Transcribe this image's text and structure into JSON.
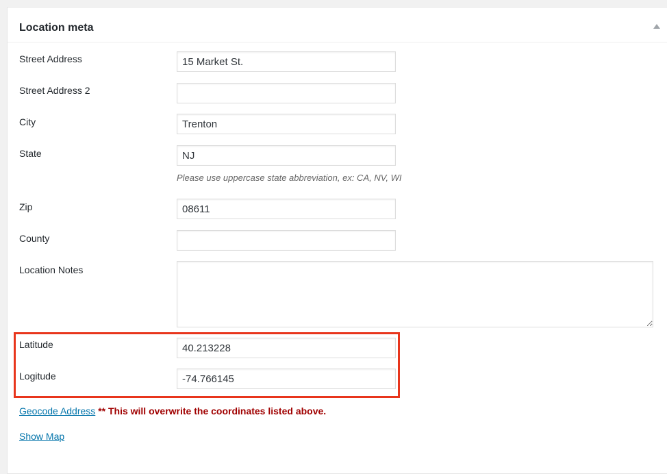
{
  "metabox": {
    "title": "Location meta"
  },
  "fields": {
    "street_address": {
      "label": "Street Address",
      "value": "15 Market St."
    },
    "street_address_2": {
      "label": "Street Address 2",
      "value": ""
    },
    "city": {
      "label": "City",
      "value": "Trenton"
    },
    "state": {
      "label": "State",
      "value": "NJ",
      "help": "Please use uppercase state abbreviation, ex: CA, NV, WI"
    },
    "zip": {
      "label": "Zip",
      "value": "08611"
    },
    "county": {
      "label": "County",
      "value": ""
    },
    "location_notes": {
      "label": "Location Notes",
      "value": ""
    },
    "latitude": {
      "label": "Latitude",
      "value": "40.213228"
    },
    "longitude": {
      "label": "Logitude",
      "value": "-74.766145"
    }
  },
  "actions": {
    "geocode_link": "Geocode Address",
    "geocode_warning": "** This will overwrite the coordinates listed above.",
    "show_map_link": "Show Map"
  },
  "colors": {
    "link": "#0073aa",
    "warning": "#a00000",
    "highlight": "#e8351c"
  },
  "icons": {
    "toggle": "collapse-arrow-icon"
  }
}
